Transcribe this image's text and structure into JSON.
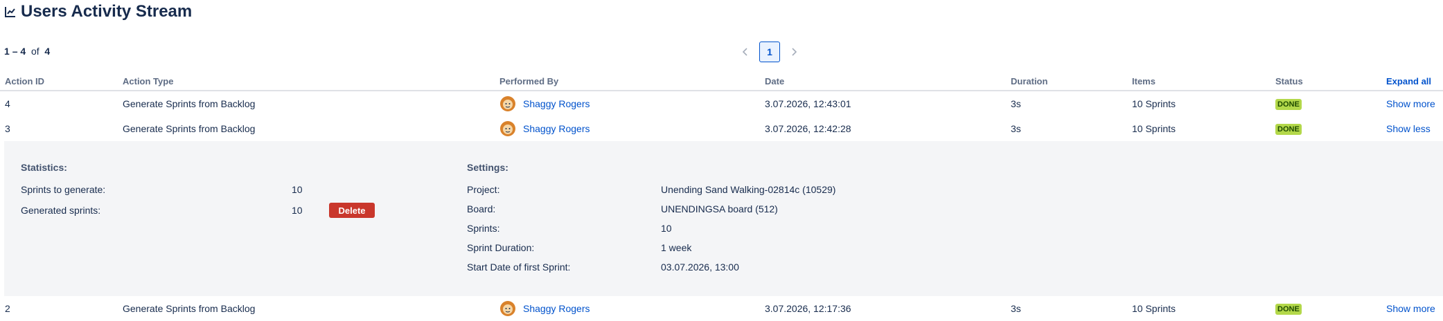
{
  "header": {
    "title": "Users Activity Stream",
    "icon": "line-chart-icon"
  },
  "summary": {
    "from": "1",
    "dash": "–",
    "to": "4",
    "of_label": "of",
    "total": "4"
  },
  "pagination": {
    "current_page": "1",
    "prev_icon": "chevron-left-icon",
    "next_icon": "chevron-right-icon"
  },
  "table": {
    "columns": {
      "action_id": "Action ID",
      "action_type": "Action Type",
      "performed_by": "Performed By",
      "date": "Date",
      "duration": "Duration",
      "items": "Items",
      "status": "Status",
      "expand_all": "Expand all"
    },
    "rows": [
      {
        "id": "4",
        "type": "Generate Sprints from Backlog",
        "user": "Shaggy Rogers",
        "date": "3.07.2026, 12:43:01",
        "duration": "3s",
        "items": "10 Sprints",
        "status": "DONE",
        "toggle": "Show more"
      },
      {
        "id": "3",
        "type": "Generate Sprints from Backlog",
        "user": "Shaggy Rogers",
        "date": "3.07.2026, 12:42:28",
        "duration": "3s",
        "items": "10 Sprints",
        "status": "DONE",
        "toggle": "Show less"
      },
      {
        "id": "2",
        "type": "Generate Sprints from Backlog",
        "user": "Shaggy Rogers",
        "date": "3.07.2026, 12:17:36",
        "duration": "3s",
        "items": "10 Sprints",
        "status": "DONE",
        "toggle": "Show more"
      }
    ]
  },
  "details": {
    "statistics": {
      "title": "Statistics:",
      "sprints_to_generate_label": "Sprints to generate:",
      "sprints_to_generate_value": "10",
      "generated_sprints_label": "Generated sprints:",
      "generated_sprints_value": "10",
      "delete_label": "Delete"
    },
    "settings": {
      "title": "Settings:",
      "project_label": "Project:",
      "project_value": "Unending Sand Walking-02814c (10529)",
      "board_label": "Board:",
      "board_value": "UNENDINGSA board (512)",
      "sprints_label": "Sprints:",
      "sprints_value": "10",
      "duration_label": "Sprint Duration:",
      "duration_value": "1 week",
      "start_label": "Start Date of first Sprint:",
      "start_value": "03.07.2026, 13:00"
    }
  },
  "colors": {
    "link": "#0052cc",
    "done_badge": "#b3d84a",
    "delete": "#c9372c",
    "panel": "#f4f5f7"
  }
}
